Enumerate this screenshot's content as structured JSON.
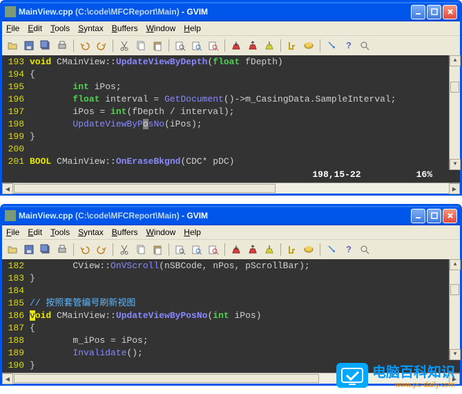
{
  "win1": {
    "title_file": "MainView.cpp",
    "title_path": "(C:\\code\\MFCReport\\Main)",
    "title_app": "- GVIM",
    "menu": [
      "File",
      "Edit",
      "Tools",
      "Syntax",
      "Buffers",
      "Window",
      "Help"
    ],
    "lines": [
      {
        "no": "193",
        "raw": [
          {
            "c": "kw",
            "t": "void"
          },
          {
            "c": "id",
            "t": " CMainView::"
          },
          {
            "c": "func2",
            "t": "UpdateViewByDepth"
          },
          {
            "c": "id",
            "t": "("
          },
          {
            "c": "type",
            "t": "float"
          },
          {
            "c": "id",
            "t": " fDepth)"
          }
        ]
      },
      {
        "no": "194",
        "raw": [
          {
            "c": "id",
            "t": "{"
          }
        ]
      },
      {
        "no": "195",
        "raw": [
          {
            "c": "id",
            "t": "        "
          },
          {
            "c": "type",
            "t": "int"
          },
          {
            "c": "id",
            "t": " iPos;"
          }
        ]
      },
      {
        "no": "196",
        "raw": [
          {
            "c": "id",
            "t": "        "
          },
          {
            "c": "type",
            "t": "float"
          },
          {
            "c": "id",
            "t": " interval = "
          },
          {
            "c": "func",
            "t": "GetDocument"
          },
          {
            "c": "id",
            "t": "()->m_CasingData.SampleInterval;"
          }
        ]
      },
      {
        "no": "197",
        "raw": [
          {
            "c": "id",
            "t": "        iPos = "
          },
          {
            "c": "type",
            "t": "int"
          },
          {
            "c": "id",
            "t": "(fDepth / interval);"
          }
        ]
      },
      {
        "no": "198",
        "raw": [
          {
            "c": "id",
            "t": "        "
          },
          {
            "c": "func",
            "t": "UpdateViewByP"
          },
          {
            "c": "cursor",
            "t": "o"
          },
          {
            "c": "func",
            "t": "sNo"
          },
          {
            "c": "id",
            "t": "(iPos);"
          }
        ]
      },
      {
        "no": "199",
        "raw": [
          {
            "c": "id",
            "t": "}"
          }
        ]
      },
      {
        "no": "200",
        "raw": [
          {
            "c": "id",
            "t": ""
          }
        ]
      },
      {
        "no": "201",
        "raw": [
          {
            "c": "kw",
            "t": "BOOL"
          },
          {
            "c": "id",
            "t": " CMainView::"
          },
          {
            "c": "func2",
            "t": "OnEraseBkgnd"
          },
          {
            "c": "id",
            "t": "(CDC* pDC)"
          }
        ]
      }
    ],
    "status_pos": "198,15-22",
    "status_pct": "16%"
  },
  "win2": {
    "title_file": "MainView.cpp",
    "title_path": "(C:\\code\\MFCReport\\Main)",
    "title_app": "- GVIM",
    "menu": [
      "File",
      "Edit",
      "Tools",
      "Syntax",
      "Buffers",
      "Window",
      "Help"
    ],
    "lines": [
      {
        "no": "182",
        "raw": [
          {
            "c": "id",
            "t": "        CView::"
          },
          {
            "c": "func",
            "t": "OnVScroll"
          },
          {
            "c": "id",
            "t": "(nSBCode, nPos, pScrollBar);"
          }
        ]
      },
      {
        "no": "183",
        "raw": [
          {
            "c": "id",
            "t": "}"
          }
        ]
      },
      {
        "no": "184",
        "raw": [
          {
            "c": "id",
            "t": ""
          }
        ]
      },
      {
        "no": "185",
        "raw": [
          {
            "c": "comment",
            "t": "// 按照套管编号刷新视图"
          }
        ]
      },
      {
        "no": "186",
        "raw": [
          {
            "c": "cursor2",
            "t": "v"
          },
          {
            "c": "kw",
            "t": "oid"
          },
          {
            "c": "id",
            "t": " CMainView::"
          },
          {
            "c": "func2",
            "t": "UpdateViewByPosNo"
          },
          {
            "c": "id",
            "t": "("
          },
          {
            "c": "type",
            "t": "int"
          },
          {
            "c": "id",
            "t": " iPos)"
          }
        ]
      },
      {
        "no": "187",
        "raw": [
          {
            "c": "id",
            "t": "{"
          }
        ]
      },
      {
        "no": "188",
        "raw": [
          {
            "c": "id",
            "t": "        m_iPos = iPos;"
          }
        ]
      },
      {
        "no": "189",
        "raw": [
          {
            "c": "id",
            "t": "        "
          },
          {
            "c": "func",
            "t": "Invalidate"
          },
          {
            "c": "id",
            "t": "();"
          }
        ]
      },
      {
        "no": "190",
        "raw": [
          {
            "c": "id",
            "t": "}"
          }
        ]
      }
    ]
  },
  "watermark": {
    "text": "电脑百科知识",
    "url": "www.pc-daily.com"
  }
}
